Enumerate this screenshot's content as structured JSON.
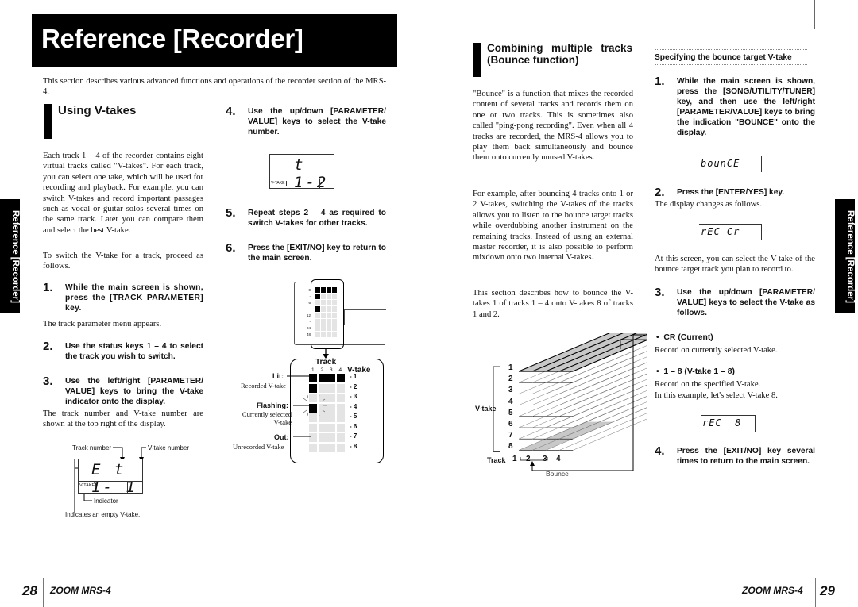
{
  "header": {
    "title": "Reference [Recorder]"
  },
  "side_tabs": {
    "left": "Reference [Recorder]",
    "right": "Reference [Recorder]"
  },
  "left_page": {
    "intro": "This section describes various advanced functions and operations of the recorder section of the MRS-4.",
    "section_title": "Using V-takes",
    "paragraph1": "Each track 1 – 4 of the recorder contains eight virtual tracks called \"V-takes\". For each track, you can select one take, which will be used for recording and playback. For example, you can switch V-takes and record important passages such as vocal or guitar solos several times on the same track. Later you can compare them and select the best V-take.",
    "paragraph2": "To switch the V-take for a track, proceed as follows.",
    "steps": [
      {
        "num": "1.",
        "text": "While the main screen is shown, press the [TRACK PARAMETER] key.",
        "note": "The track parameter menu appears."
      },
      {
        "num": "2.",
        "text": "Use the status keys 1 – 4 to select the track you wish to switch.",
        "note": ""
      },
      {
        "num": "3.",
        "text": "Use the left/right [PARAMETER/ VALUE] keys to bring the V-take indicator onto the display.",
        "note": "The track number and V-take number are shown at the top right of the display."
      },
      {
        "num": "4.",
        "text": "Use the up/down [PARAMETER/ VALUE] keys to select the V-take number.",
        "note": ""
      },
      {
        "num": "5.",
        "text": "Repeat steps 2 – 4 as required to switch V-takes for other tracks.",
        "note": ""
      },
      {
        "num": "6.",
        "text": "Press the [EXIT/NO] key to return to the main screen.",
        "note": ""
      }
    ],
    "display1": {
      "lcd_text": "E t 1- 1",
      "indicator_label": "V-TAKE",
      "callout_track_number": "Track number",
      "callout_vtake_number": "V-take number",
      "callout_indicator": "Indicator",
      "callout_empty": "Indicates an empty V-take."
    },
    "display2": {
      "lcd_text": "t 1-2",
      "indicator_label": "V-TAKE"
    },
    "meter_diagram": {
      "track_label": "Track",
      "vtake_label": "V-take",
      "track_numbers": [
        "1",
        "2",
        "3",
        "4"
      ],
      "vtake_numbers": [
        "- 1",
        "- 2",
        "- 3",
        "- 4",
        "- 5",
        "- 6",
        "- 7",
        "- 8"
      ],
      "scale_labels": [
        "0",
        "-",
        "6",
        "-",
        "12",
        "-",
        "24",
        "48"
      ],
      "lit_label": "Lit:",
      "lit_desc": "Recorded V-take",
      "flashing_label": "Flashing:",
      "flashing_desc": "Currently selected V-take",
      "out_label": "Out:",
      "out_desc": "Unrecorded V-take",
      "lit_cells": [
        [
          0,
          0
        ],
        [
          1,
          0
        ],
        [
          2,
          0
        ],
        [
          3,
          0
        ],
        [
          0,
          1
        ]
      ],
      "flashing_cells": [
        [
          0,
          3
        ]
      ]
    }
  },
  "right_page": {
    "section_title": "Combining multiple tracks (Bounce function)",
    "paragraph1": "\"Bounce\" is a function that mixes the recorded content of several tracks and records them on one or two tracks. This is sometimes also called \"ping-pong recording\". Even when all 4 tracks are recorded, the MRS-4 allows you to play them back simultaneously and bounce them onto currently unused V-takes.",
    "paragraph2": "For example, after bouncing 4 tracks onto 1 or 2 V-takes, switching the V-takes of the tracks allows you to listen to the bounce target tracks while overdubbing another instrument on the remaining tracks. Instead of using an external master recorder, it is also possible to perform mixdown onto two internal V-takes.",
    "paragraph3": "This section describes how to bounce the V-takes 1 of tracks 1 – 4 onto V-takes 8 of tracks 1 and 2.",
    "bounce_diagram": {
      "vtake_label": "V-take",
      "track_label": "Track",
      "bounce_label": "Bounce",
      "vtake_numbers": [
        "1",
        "2",
        "3",
        "4",
        "5",
        "6",
        "7",
        "8"
      ],
      "track_numbers": [
        "1",
        "2",
        "3",
        "4"
      ]
    },
    "subsection_title": "Specifying the bounce target V-take",
    "steps": [
      {
        "num": "1.",
        "text": "While the main screen is shown, press the [SONG/UTILITY/TUNER] key, and then use the left/right [PARAMETER/VALUE] keys to bring the indication \"BOUNCE\" onto the display."
      },
      {
        "num": "2.",
        "text": "Press the [ENTER/YES] key."
      },
      {
        "num": "3.",
        "text": "Use the up/down [PARAMETER/ VALUE] keys to select the V-take as follows."
      },
      {
        "num": "4.",
        "text": "Press the [EXIT/NO] key several times to return to the main screen."
      }
    ],
    "lcd_bounce": "bounCE",
    "step2_note": "The display changes as follows.",
    "lcd_rec_cr": "rEC Cr",
    "step2_note2": "At this screen, you can select the V-take of the bounce target track you plan to record to.",
    "bullets": [
      {
        "head": "CR (Current)",
        "desc": "Record on currently selected V-take."
      },
      {
        "head": "1 – 8 (V-take 1 – 8)",
        "desc": "Record on the specified V-take."
      }
    ],
    "example_note": "In this example, let's select V-take 8.",
    "lcd_rec_8": "rEC  8"
  },
  "footer": {
    "left_page_num": "28",
    "left_brand": "ZOOM MRS-4",
    "right_brand": "ZOOM MRS-4",
    "right_page_num": "29"
  }
}
